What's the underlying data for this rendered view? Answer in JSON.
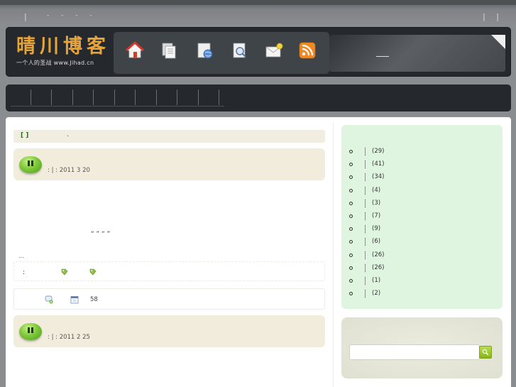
{
  "topbar": {
    "sep_left": "|",
    "dots": "- - - -",
    "sep_right": "| |"
  },
  "header": {
    "logo_title": "晴川博客",
    "logo_subtitle": "一个人的圣战 www.Jihad.cn",
    "nav_icons": [
      "home-icon",
      "pages-icon",
      "browser-icon",
      "search-icon",
      "mail-icon",
      "rss-icon"
    ]
  },
  "main": {
    "notice": {
      "brackets": "[ ]",
      "dot": "."
    },
    "posts": [
      {
        "meta": ": |   : 2011 3 20"
      },
      {
        "meta": ": |   : 2011 2 25"
      }
    ],
    "quote": "“     ”  “     ”",
    "ellipsis": "...",
    "tag_colon": ":",
    "comment_count": "58"
  },
  "sidebar": {
    "categories": [
      {
        "count": "(29)"
      },
      {
        "count": "(41)"
      },
      {
        "count": "(34)"
      },
      {
        "count": "(4)"
      },
      {
        "count": "(3)"
      },
      {
        "count": "(7)"
      },
      {
        "count": "(9)"
      },
      {
        "count": "(6)"
      },
      {
        "count": "(26)"
      },
      {
        "count": "(26)"
      },
      {
        "count": "(1)"
      },
      {
        "count": "(2)"
      }
    ],
    "search": {
      "placeholder": "",
      "button_icon": "search-icon"
    }
  },
  "colors": {
    "accent": "#e7a43a",
    "header_bg": "#25292e",
    "sidebar_bg": "#dff5df",
    "post_head_bg": "#f1ecdc"
  }
}
